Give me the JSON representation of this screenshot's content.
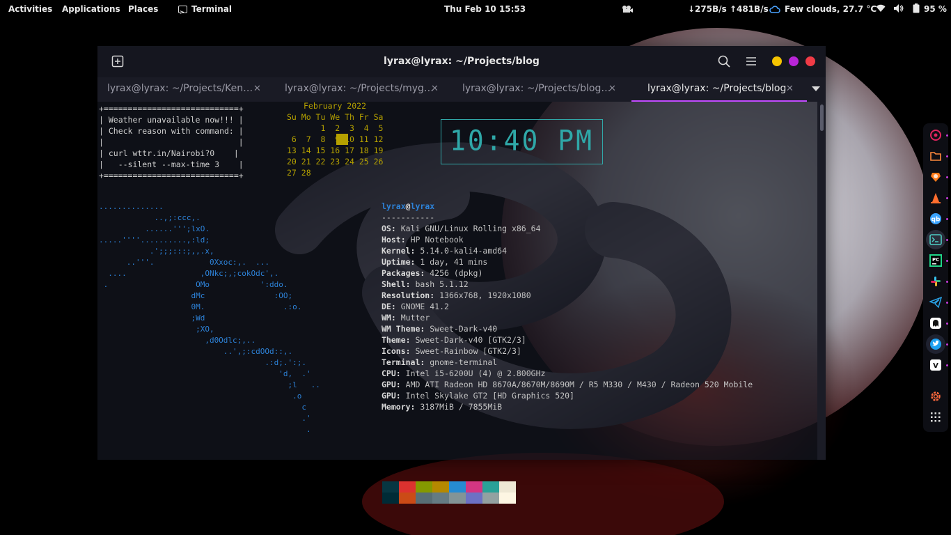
{
  "topbar": {
    "activities": "Activities",
    "applications": "Applications",
    "places": "Places",
    "terminal": "Terminal",
    "datetime": "Thu Feb 10  15:53",
    "network": "↓275B/s ↑481B/s",
    "weather": "Few clouds, 27.7 °C",
    "battery": "95 %"
  },
  "window": {
    "title": "lyrax@lyrax: ~/Projects/blog",
    "tabs": [
      {
        "label": "lyrax@lyrax: ~/Projects/Ken…",
        "active": false
      },
      {
        "label": "lyrax@lyrax: ~/Projects/myg…",
        "active": false
      },
      {
        "label": "lyrax@lyrax: ~/Projects/blog…",
        "active": false
      },
      {
        "label": "lyrax@lyrax: ~/Projects/blog",
        "active": true
      }
    ],
    "close_glyph": "✕"
  },
  "weather_box": "+============================+\n| Weather unavailable now!!! |\n| Check reason with command: |\n|                            |\n| curl wttr.in/Nairobi?0    |\n|   --silent --max-time 3    |\n+============================+",
  "calendar": {
    "title": "February 2022",
    "body": "\nSu Mo Tu We Th Fr Sa\n       1  2  3  4  5\n 6  7  8  9 10 11 12\n13 14 15 16 17 18 19\n20 21 22 23 24 25 26\n27 28"
  },
  "clock": "10:40 PM",
  "ascii_art": "..............\n            ..,;:ccc,.\n          ......''';lxO.\n.....''''..........,:ld;\n           .';;;:::;,,.x,\n      ..'''.            0Xxoc:,.  ...\n  ....                ,ONkc;,;cokOdc',.\n .                   OMo           ':ddo.\n                    dMc               :OO;\n                    0M.                 .:o.\n                    ;Wd\n                     ;XO,\n                       ,d0Odlc;,..\n                           ..',;:cdOOd::,.\n                                    .:d;.':;.\n                                       'd,  .'\n                                         ;l   ..\n                                          .o\n                                            c\n                                            .'\n                                             .",
  "neofetch": {
    "user": "lyrax",
    "at": "@",
    "host": "lyrax",
    "separator": "-----------",
    "rows": [
      {
        "key": "OS",
        "value": "Kali GNU/Linux Rolling x86_64"
      },
      {
        "key": "Host",
        "value": "HP Notebook"
      },
      {
        "key": "Kernel",
        "value": "5.14.0-kali4-amd64"
      },
      {
        "key": "Uptime",
        "value": "1 day, 41 mins"
      },
      {
        "key": "Packages",
        "value": "4256 (dpkg)"
      },
      {
        "key": "Shell",
        "value": "bash 5.1.12"
      },
      {
        "key": "Resolution",
        "value": "1366x768, 1920x1080"
      },
      {
        "key": "DE",
        "value": "GNOME 41.2"
      },
      {
        "key": "WM",
        "value": "Mutter"
      },
      {
        "key": "WM Theme",
        "value": "Sweet-Dark-v40"
      },
      {
        "key": "Theme",
        "value": "Sweet-Dark-v40 [GTK2/3]"
      },
      {
        "key": "Icons",
        "value": "Sweet-Rainbow [GTK2/3]"
      },
      {
        "key": "Terminal",
        "value": "gnome-terminal"
      },
      {
        "key": "CPU",
        "value": "Intel i5-6200U (4) @ 2.800GHz"
      },
      {
        "key": "GPU",
        "value": "AMD ATI Radeon HD 8670A/8670M/8690M / R5 M330 / M430 / Radeon 520 Mobile"
      },
      {
        "key": "GPU",
        "value": "Intel Skylake GT2 [HD Graphics 520]"
      },
      {
        "key": "Memory",
        "value": "3187MiB / 7855MiB"
      }
    ]
  },
  "palette": {
    "row1": [
      "#073642",
      "#dc322f",
      "#859900",
      "#b58900",
      "#268bd2",
      "#d33682",
      "#2aa198",
      "#eee8d5"
    ],
    "row2": [
      "#002b36",
      "#cb4b16",
      "#586e75",
      "#657b83",
      "#839496",
      "#6c71c4",
      "#93a1a1",
      "#fdf6e3"
    ]
  },
  "dock": [
    {
      "name": "radial-app-icon",
      "color": "#e0245e"
    },
    {
      "name": "files-icon",
      "color": "#ff8a3d"
    },
    {
      "name": "brave-browser-icon",
      "color": "#ff7a1a"
    },
    {
      "name": "vlc-cone-icon",
      "color": "#ff6d2e"
    },
    {
      "name": "qbittorrent-icon",
      "color": "#3aa3ff"
    },
    {
      "name": "terminal-icon",
      "color": "#4ecdc4"
    },
    {
      "name": "pycharm-icon",
      "color": "#21d789"
    },
    {
      "name": "slack-icon",
      "color": "#e01e5a"
    },
    {
      "name": "telegram-icon",
      "color": "#2aa3e8"
    },
    {
      "name": "ghost-app-icon",
      "color": "#ffffff"
    },
    {
      "name": "twitter-icon",
      "color": "#1da1f2"
    },
    {
      "name": "vscode-icon",
      "color": "#ffffff"
    },
    {
      "name": "settings-gear-icon",
      "color": "#ff6a3d"
    },
    {
      "name": "show-apps-grid-icon",
      "color": "#dddddd"
    }
  ]
}
